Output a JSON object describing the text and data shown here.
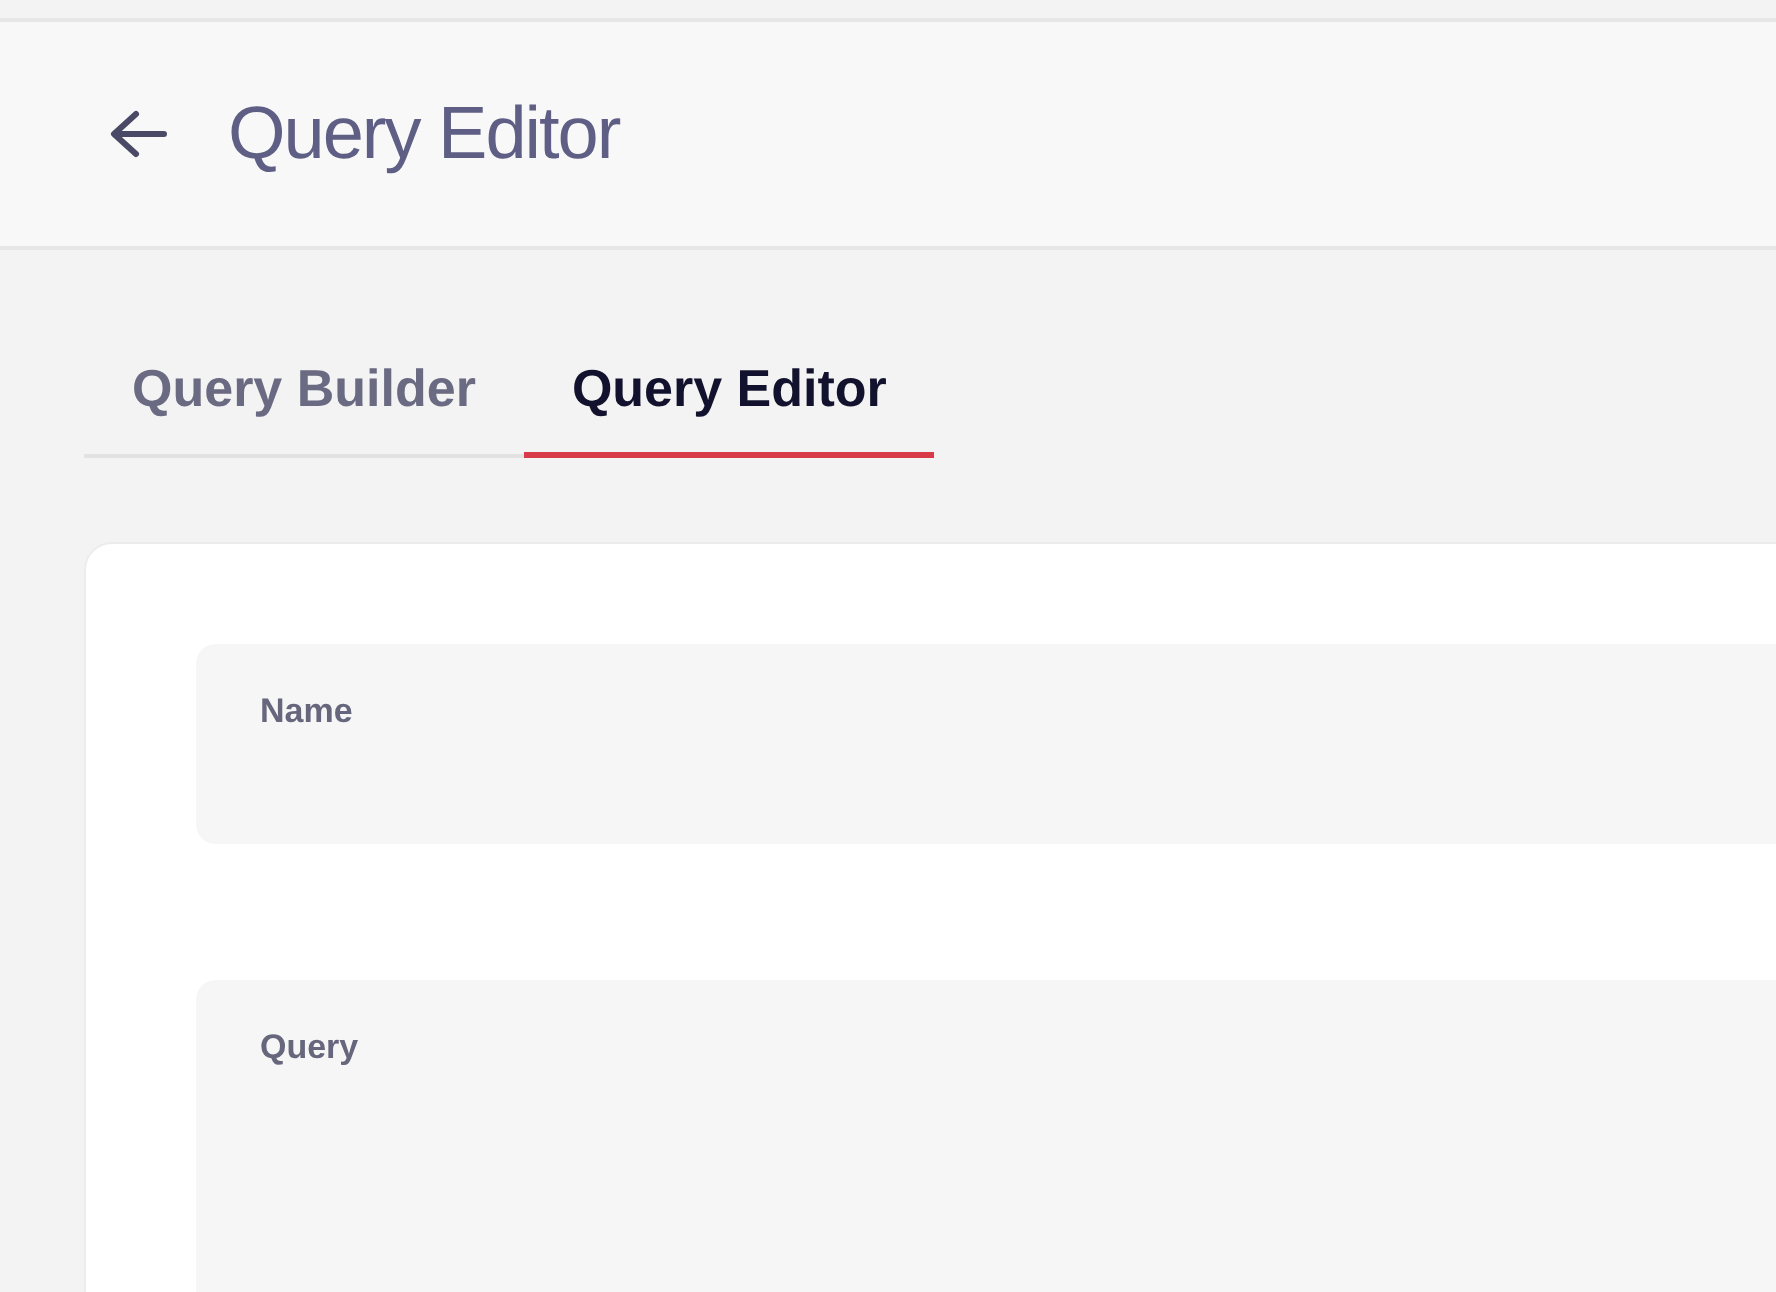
{
  "header": {
    "title": "Query Editor"
  },
  "tabs": [
    {
      "label": "Query Builder",
      "selected": false
    },
    {
      "label": "Query Editor",
      "selected": true
    }
  ],
  "form": {
    "fields": [
      {
        "label": "Name",
        "kind": "text"
      },
      {
        "label": "Query",
        "kind": "textarea"
      }
    ]
  }
}
